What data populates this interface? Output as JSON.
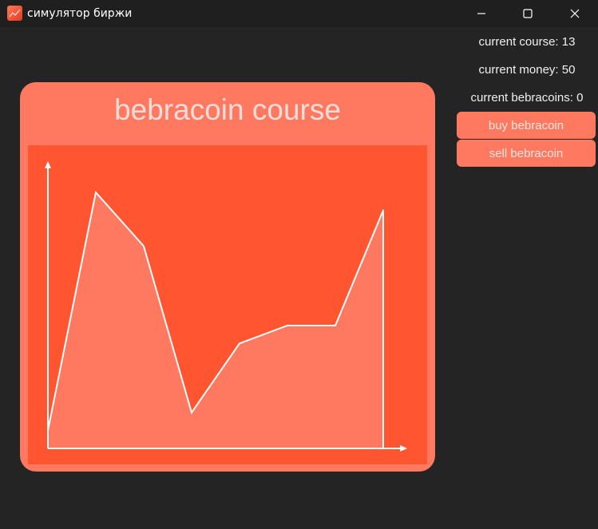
{
  "window": {
    "title": "симулятор биржи",
    "icon": "chart-app-icon",
    "controls": [
      "minimize-icon",
      "maximize-icon",
      "close-icon"
    ]
  },
  "chart_card": {
    "title": "bebracoin course"
  },
  "info": {
    "course": "current course: 13",
    "money": "current money: 50",
    "bebracoins": "current bebracoins: 0"
  },
  "actions": {
    "buy_label": "buy bebracoin",
    "sell_label": "sell bebracoin"
  },
  "colors": {
    "background": "#242424",
    "titlebar": "#1f1f1f",
    "card": "#ff7961",
    "plot_area": "#ff5530",
    "area_fill": "#ff7961",
    "line": "#ffffff"
  },
  "chart_data": {
    "type": "area",
    "title": "bebracoin course",
    "xlabel": "",
    "ylabel": "",
    "x": [
      0,
      1,
      2,
      3,
      4,
      5,
      6,
      7
    ],
    "values": [
      0.7,
      10.0,
      7.9,
      1.4,
      4.1,
      4.8,
      4.8,
      9.3
    ],
    "ylim": [
      0,
      11
    ],
    "grid": false,
    "legend": "none"
  }
}
